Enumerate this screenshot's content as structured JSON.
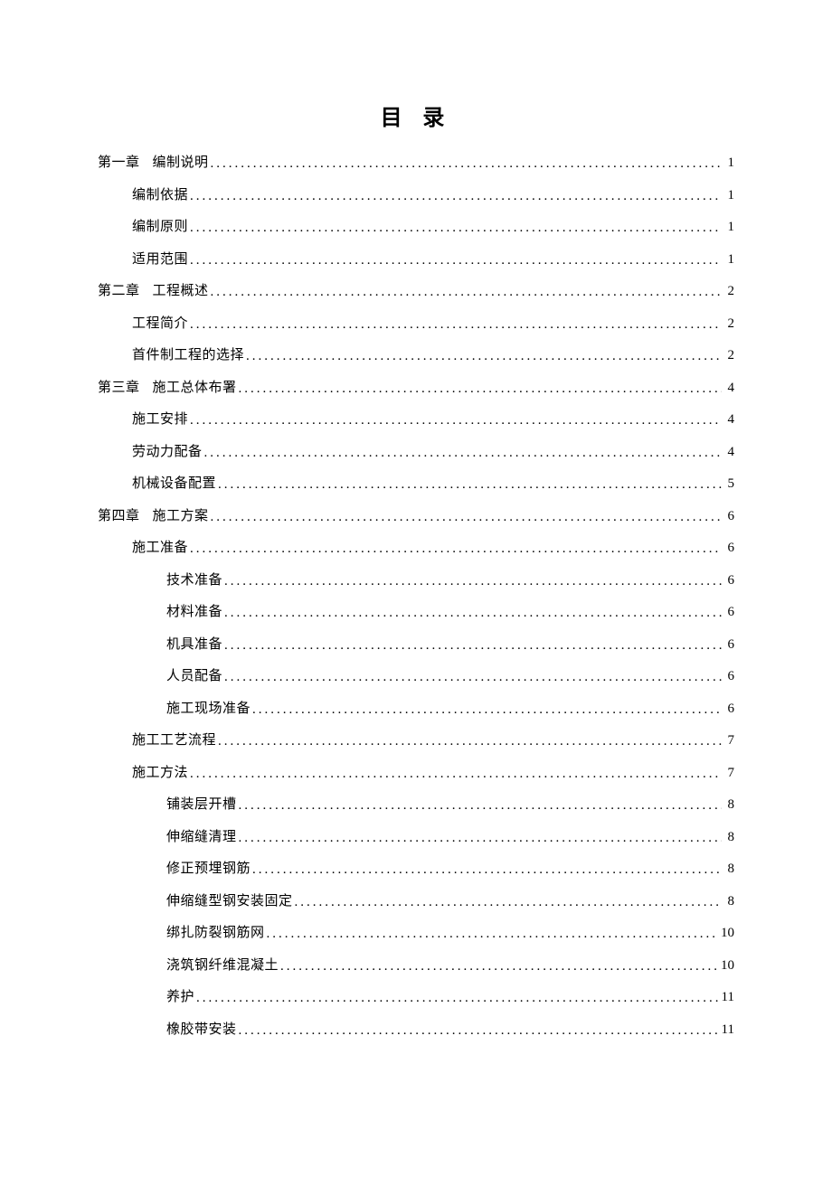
{
  "title": "目  录",
  "entries": [
    {
      "level": 1,
      "prefix": "第一章",
      "label": "编制说明",
      "page": "1"
    },
    {
      "level": 2,
      "prefix": "",
      "label": "编制依据",
      "page": "1"
    },
    {
      "level": 2,
      "prefix": "",
      "label": "编制原则",
      "page": "1"
    },
    {
      "level": 2,
      "prefix": "",
      "label": "适用范围",
      "page": "1"
    },
    {
      "level": 1,
      "prefix": "第二章",
      "label": "工程概述",
      "page": "2"
    },
    {
      "level": 2,
      "prefix": "",
      "label": "工程简介",
      "page": "2"
    },
    {
      "level": 2,
      "prefix": "",
      "label": "首件制工程的选择",
      "page": "2"
    },
    {
      "level": 1,
      "prefix": "第三章",
      "label": "施工总体布署",
      "page": "4"
    },
    {
      "level": 2,
      "prefix": "",
      "label": "施工安排",
      "page": "4"
    },
    {
      "level": 2,
      "prefix": "",
      "label": "劳动力配备",
      "page": "4"
    },
    {
      "level": 2,
      "prefix": "",
      "label": "机械设备配置",
      "page": "5"
    },
    {
      "level": 1,
      "prefix": "第四章",
      "label": "施工方案",
      "page": "6"
    },
    {
      "level": 2,
      "prefix": "",
      "label": "施工准备",
      "page": "6"
    },
    {
      "level": 3,
      "prefix": "",
      "label": "技术准备",
      "page": "6"
    },
    {
      "level": 3,
      "prefix": "",
      "label": "材料准备",
      "page": "6"
    },
    {
      "level": 3,
      "prefix": "",
      "label": "机具准备",
      "page": "6"
    },
    {
      "level": 3,
      "prefix": "",
      "label": "人员配备",
      "page": "6"
    },
    {
      "level": 3,
      "prefix": "",
      "label": "施工现场准备",
      "page": "6"
    },
    {
      "level": 2,
      "prefix": "",
      "label": "施工工艺流程",
      "page": "7"
    },
    {
      "level": 2,
      "prefix": "",
      "label": "施工方法",
      "page": "7"
    },
    {
      "level": 3,
      "prefix": "",
      "label": "铺装层开槽",
      "page": "8"
    },
    {
      "level": 3,
      "prefix": "",
      "label": "伸缩缝清理",
      "page": "8"
    },
    {
      "level": 3,
      "prefix": "",
      "label": "修正预埋钢筋",
      "page": "8"
    },
    {
      "level": 3,
      "prefix": "",
      "label": "伸缩缝型钢安装固定",
      "page": "8"
    },
    {
      "level": 3,
      "prefix": "",
      "label": "绑扎防裂钢筋网",
      "page": "10"
    },
    {
      "level": 3,
      "prefix": "",
      "label": "浇筑钢纤维混凝土",
      "page": "10"
    },
    {
      "level": 3,
      "prefix": "",
      "label": "养护",
      "page": "11"
    },
    {
      "level": 3,
      "prefix": "",
      "label": "橡胶带安装",
      "page": "11"
    }
  ]
}
